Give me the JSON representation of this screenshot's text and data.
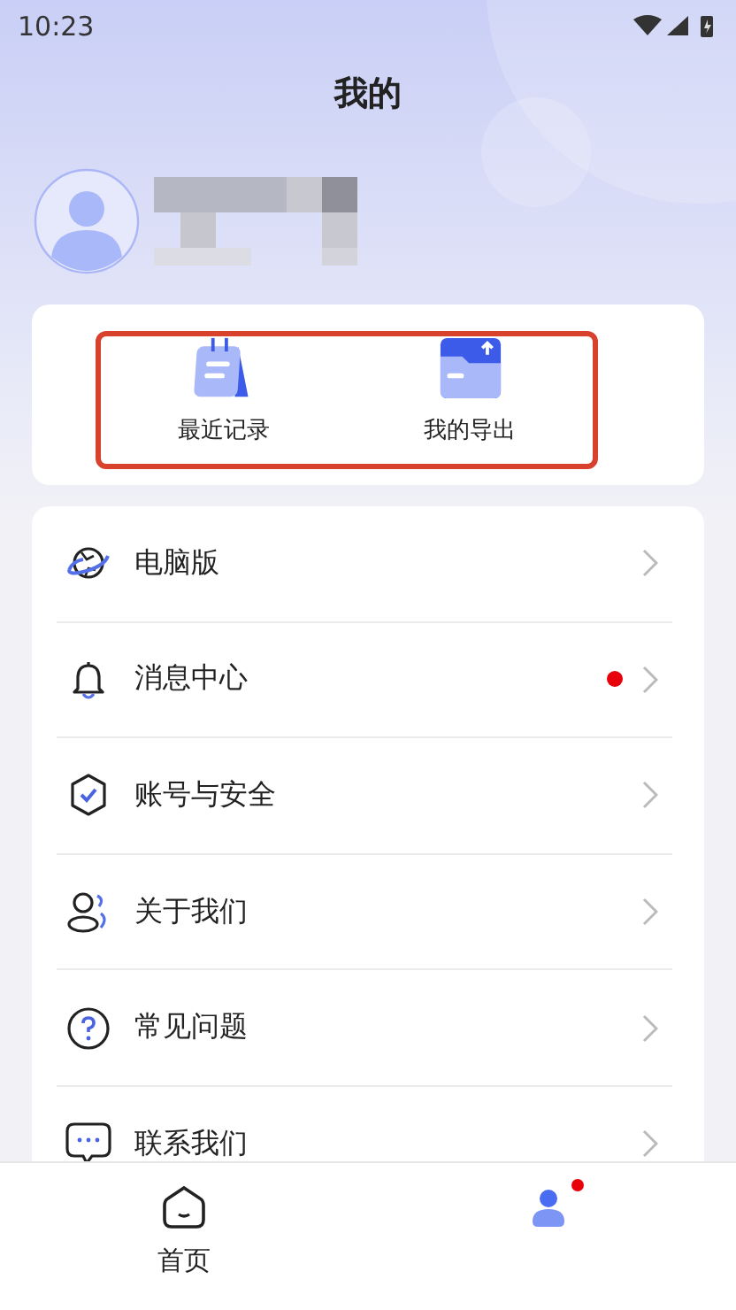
{
  "status_bar": {
    "time": "10:23"
  },
  "header": {
    "title": "我的"
  },
  "quick_actions": {
    "highlighted": true,
    "items": [
      {
        "label": "最近记录"
      },
      {
        "label": "我的导出"
      }
    ]
  },
  "menu": [
    {
      "label": "电脑版",
      "dot": false
    },
    {
      "label": "消息中心",
      "dot": true
    },
    {
      "label": "账号与安全",
      "dot": false
    },
    {
      "label": "关于我们",
      "dot": false
    },
    {
      "label": "常见问题",
      "dot": false
    },
    {
      "label": "联系我们",
      "dot": false
    }
  ],
  "tab_bar": [
    {
      "label": "首页",
      "selected": false,
      "dot": false
    },
    {
      "selected": true,
      "dot": true
    }
  ]
}
